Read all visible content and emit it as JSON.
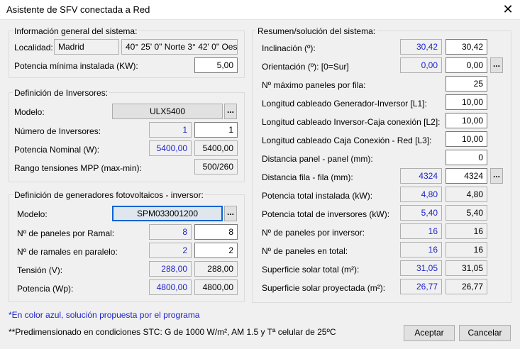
{
  "window": {
    "title": "Asistente de SFV conectada a Red",
    "close_glyph": "✕"
  },
  "general": {
    "title": "Información general del sistema:",
    "localidad_label": "Localidad:",
    "localidad_value": "Madrid",
    "coords": "40° 25' 0\" Norte 3° 42' 0\" Oeste",
    "potencia_min_label": "Potencia mínima instalada (KW):",
    "potencia_min_value": "5,00"
  },
  "inversores": {
    "title": "Definición de Inversores:",
    "modelo_label": "Modelo:",
    "modelo_value": "ULX5400",
    "browse": "...",
    "numero_label": "Número de Inversores:",
    "numero_suggested": "1",
    "numero_value": "1",
    "potencia_label": "Potencia Nominal (W):",
    "potencia_suggested": "5400,00",
    "potencia_value": "5400,00",
    "rango_label": "Rango tensiones MPP (max-min):",
    "rango_value": "500/260"
  },
  "generadores": {
    "title": "Definición de generadores fotovoltaicos - inversor:",
    "modelo_label": "Modelo:",
    "modelo_value": "SPM033001200",
    "browse": "...",
    "paneles_label": "Nº de paneles por Ramal:",
    "paneles_suggested": "8",
    "paneles_value": "8",
    "ramales_label": "Nº de ramales en paralelo:",
    "ramales_suggested": "2",
    "ramales_value": "2",
    "tension_label": "Tensión (V):",
    "tension_suggested": "288,00",
    "tension_value": "288,00",
    "potencia_label": "Potencia (Wp):",
    "potencia_suggested": "4800,00",
    "potencia_value": "4800,00"
  },
  "resumen": {
    "title": "Resumen/solución del sistema:",
    "browse": "...",
    "rows": [
      {
        "label": "Inclinación (º):",
        "suggested": "30,42",
        "value": "30,42"
      },
      {
        "label": "Orientación (º): [0=Sur]",
        "suggested": "0,00",
        "value": "0,00"
      },
      {
        "label": "Nº máximo paneles por fila:",
        "suggested": "",
        "value": "25"
      },
      {
        "label": "Longitud cableado Generador-Inversor [L1]:",
        "suggested": "",
        "value": "10,00"
      },
      {
        "label": "Longitud cableado Inversor-Caja conexión [L2]:",
        "suggested": "",
        "value": "10,00"
      },
      {
        "label": "Longitud cableado Caja Conexión - Red [L3]:",
        "suggested": "",
        "value": "10,00"
      },
      {
        "label": "Distancia panel - panel (mm):",
        "suggested": "",
        "value": "0"
      },
      {
        "label": "Distancia fila - fila (mm):",
        "suggested": "4324",
        "value": "4324"
      },
      {
        "label": "Potencia total instalada (kW):",
        "suggested": "4,80",
        "value": "4,80"
      },
      {
        "label": "Potencia total de inversores (kW):",
        "suggested": "5,40",
        "value": "5,40"
      },
      {
        "label": "Nº de paneles por inversor:",
        "suggested": "16",
        "value": "16"
      },
      {
        "label": "Nº de paneles en total:",
        "suggested": "16",
        "value": "16"
      },
      {
        "label": "Superficie solar total (m²):",
        "suggested": "31,05",
        "value": "31,05"
      },
      {
        "label": "Superficie solar proyectada (m²):",
        "suggested": "26,77",
        "value": "26,77"
      }
    ]
  },
  "notes": {
    "blue": "*En color azul, solución propuesta por el programa",
    "stc": "**Predimensionado en condiciones STC: G de 1000 W/m², AM 1.5 y Tª celular de 25ºC"
  },
  "buttons": {
    "accept": "Aceptar",
    "cancel": "Cancelar"
  },
  "colors": {
    "suggested_text": "#1e24c8",
    "focus_border": "#0a64d2"
  }
}
